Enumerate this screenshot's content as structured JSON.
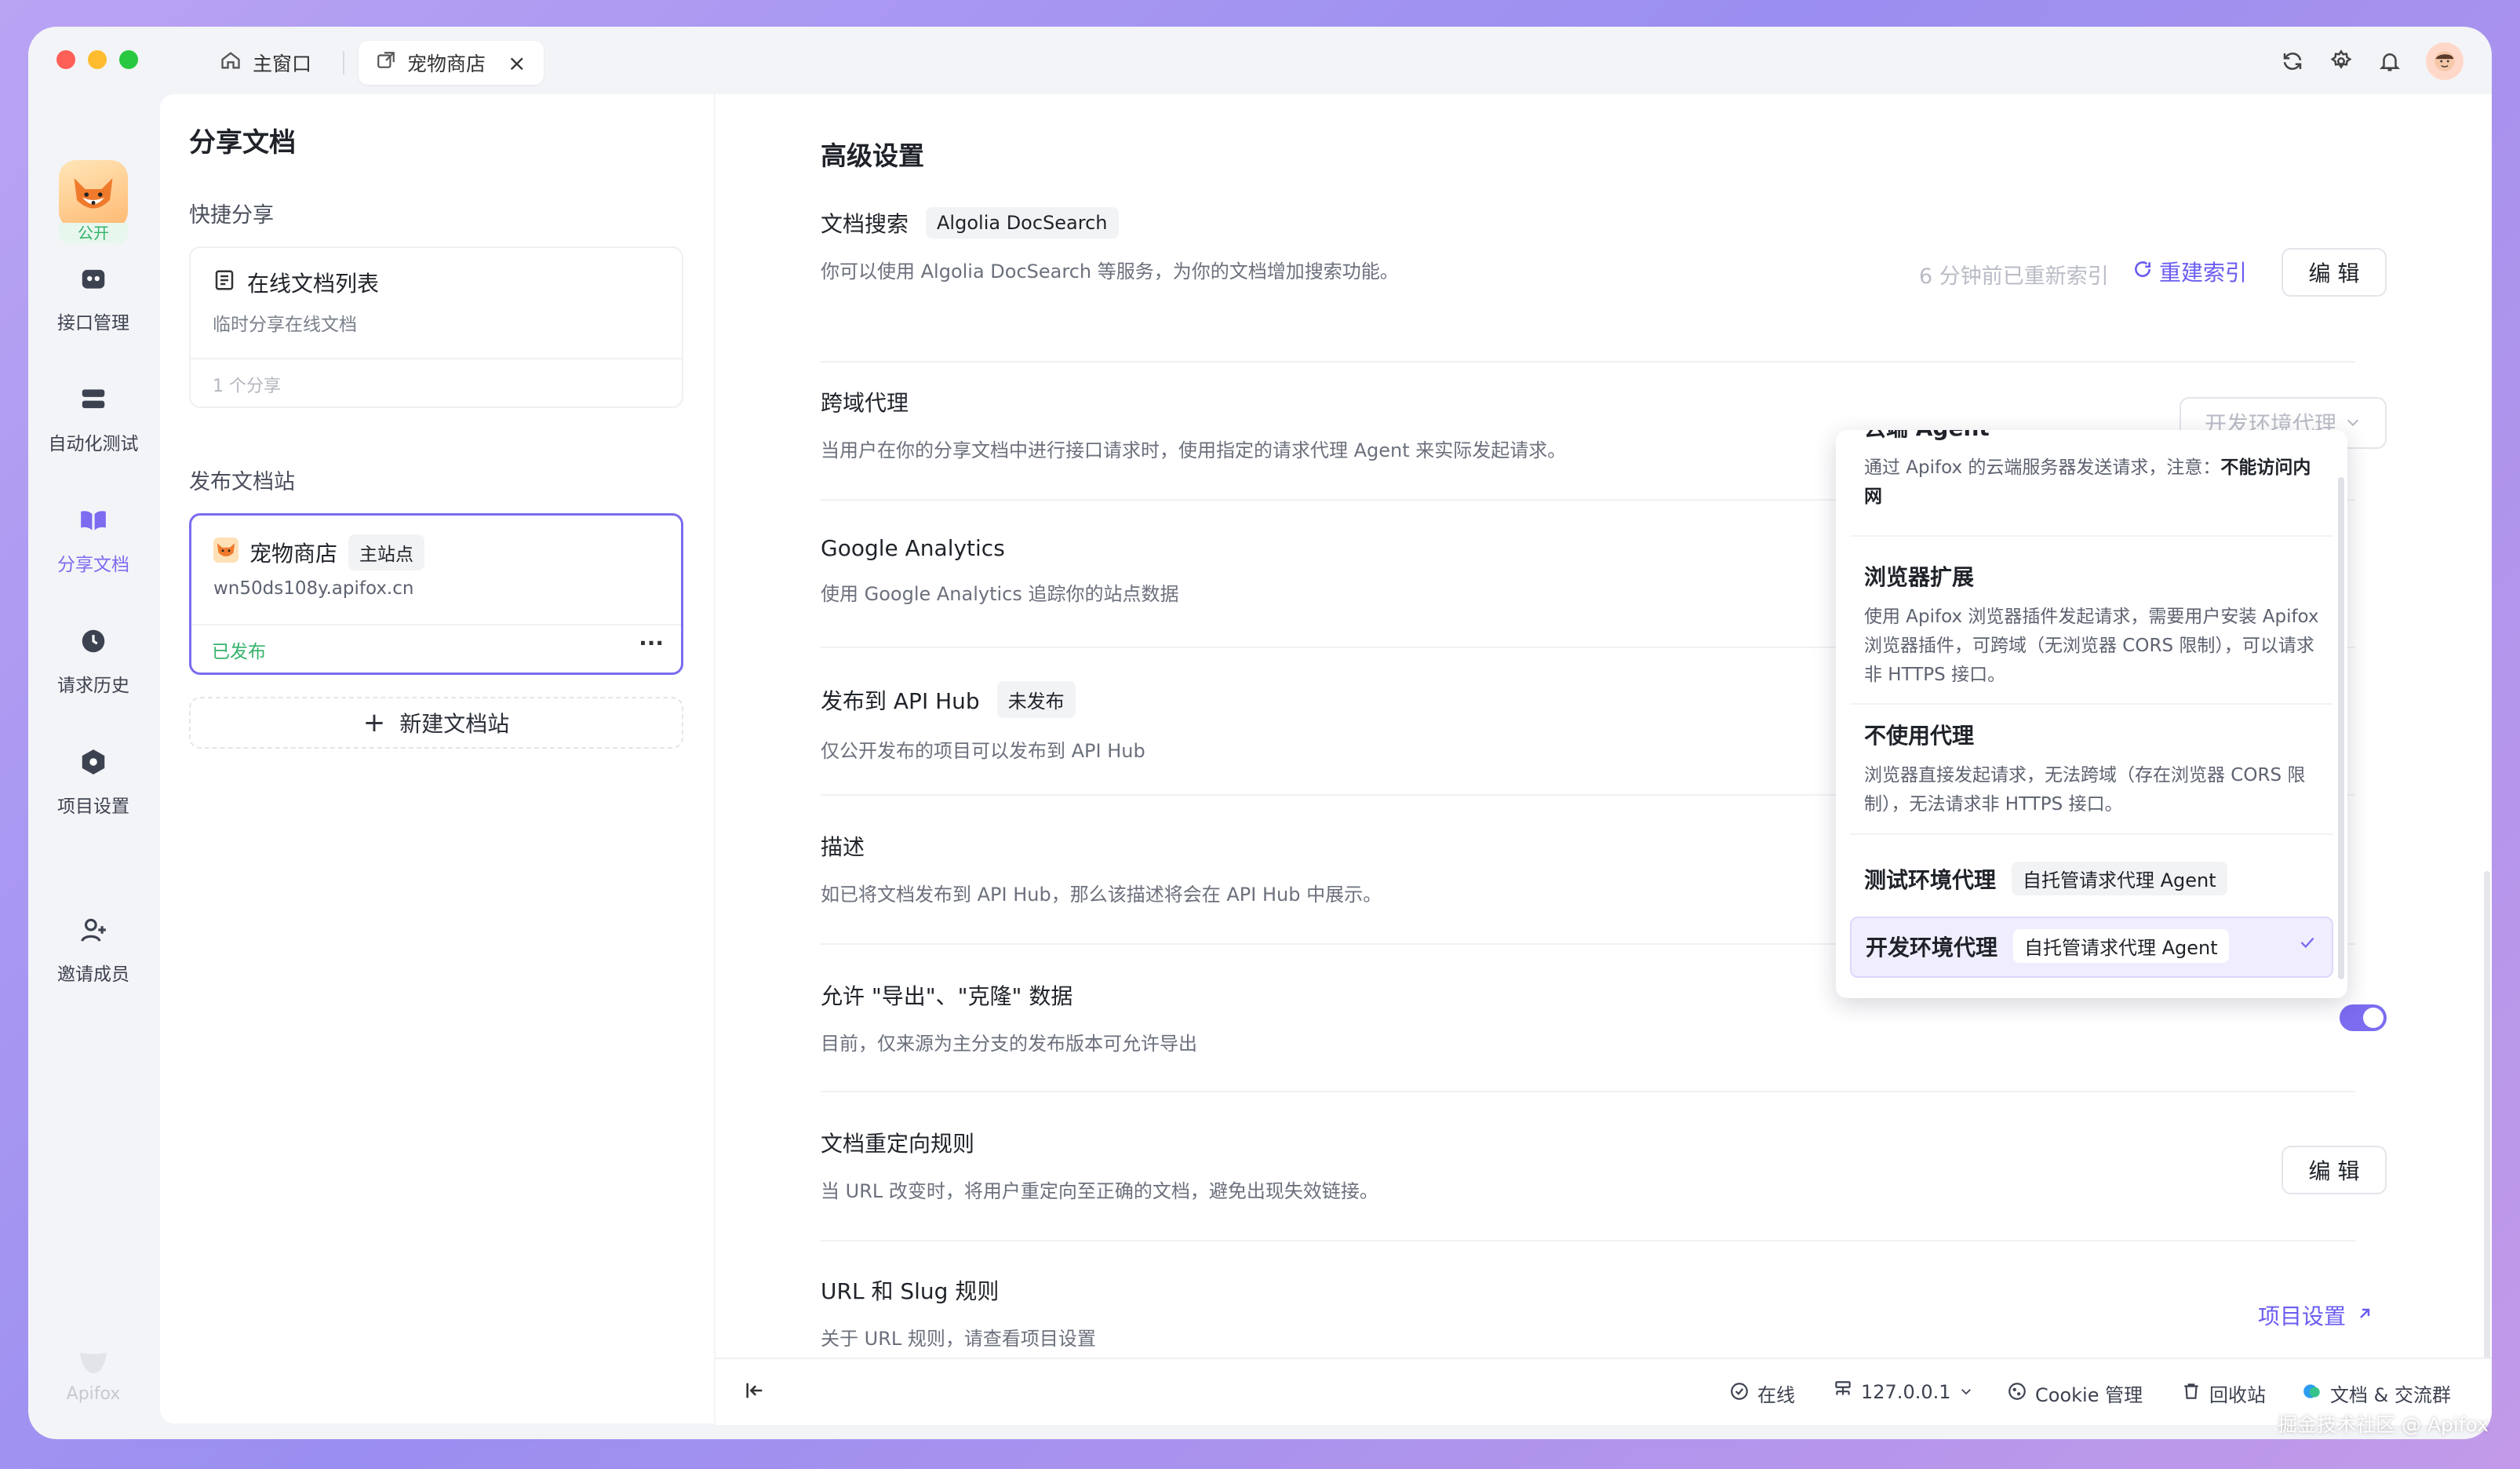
{
  "colors": {
    "accent": "#7b6cf0",
    "green": "#34b36b",
    "link": "#6a5cf0"
  },
  "tabs": [
    {
      "label": "主窗口",
      "icon": "home-icon"
    },
    {
      "label": "宠物商店",
      "icon": "external-link-icon"
    }
  ],
  "nav": {
    "public_badge": "公开",
    "items": [
      {
        "label": "接口管理",
        "icon": "api-icon"
      },
      {
        "label": "自动化测试",
        "icon": "automation-icon"
      },
      {
        "label": "分享文档",
        "icon": "book-icon"
      },
      {
        "label": "请求历史",
        "icon": "history-icon"
      },
      {
        "label": "项目设置",
        "icon": "settings-hex-icon"
      },
      {
        "label": "邀请成员",
        "icon": "invite-user-icon"
      }
    ],
    "brand": "Apifox"
  },
  "left_panel": {
    "title": "分享文档",
    "quick_share": "快捷分享",
    "online_docs": {
      "title": "在线文档列表",
      "sub": "临时分享在线文档",
      "count": "1 个分享"
    },
    "publish_section": "发布文档站",
    "site": {
      "name": "宠物商店",
      "tag": "主站点",
      "url": "wn50ds108y.apifox.cn",
      "status": "已发布",
      "more": "···"
    },
    "add_site": "新建文档站"
  },
  "main": {
    "title": "高级设置",
    "doc_search": {
      "title": "文档搜索",
      "tag": "Algolia DocSearch",
      "desc": "你可以使用 Algolia DocSearch 等服务，为你的文档增加搜索功能。",
      "reindex_time": "6 分钟前已重新索引",
      "reindex": "重建索引",
      "edit": "编 辑"
    },
    "proxy": {
      "title": "跨域代理",
      "desc": "当用户在你的分享文档中进行接口请求时，使用指定的请求代理 Agent 来实际发起请求。",
      "select": "开发环境代理"
    },
    "ga": {
      "title": "Google Analytics",
      "desc": "使用 Google Analytics 追踪你的站点数据"
    },
    "apihub": {
      "title": "发布到 API Hub",
      "tag": "未发布",
      "desc": "仅公开发布的项目可以发布到 API Hub"
    },
    "describe": {
      "title": "描述",
      "desc": "如已将文档发布到 API Hub，那么该描述将会在 API Hub 中展示。"
    },
    "export": {
      "title": "允许 \"导出\"、\"克隆\" 数据",
      "desc": "目前，仅来源为主分支的发布版本可允许导出"
    },
    "redirect": {
      "title": "文档重定向规则",
      "desc": "当 URL 改变时，将用户重定向至正确的文档，避免出现失效链接。",
      "edit": "编 辑"
    },
    "slug": {
      "title": "URL 和 Slug 规则",
      "desc": "关于 URL 规则，请查看项目设置",
      "link": "项目设置"
    }
  },
  "dropdown": {
    "cloud": {
      "title": "云端 Agent",
      "desc_a": "通过 Apifox 的云端服务器发送请求，注意：",
      "desc_b": "不能访问内网"
    },
    "browser": {
      "title": "浏览器扩展",
      "desc": "使用 Apifox 浏览器插件发起请求，需要用户安装 Apifox 浏览器插件，可跨域（无浏览器 CORS 限制），可以请求非 HTTPS 接口。"
    },
    "none": {
      "title": "不使用代理",
      "desc": "浏览器直接发起请求，无法跨域（存在浏览器 CORS 限制），无法请求非 HTTPS 接口。"
    },
    "test": {
      "title": "测试环境代理",
      "tag": "自托管请求代理 Agent"
    },
    "dev": {
      "title": "开发环境代理",
      "tag": "自托管请求代理 Agent"
    }
  },
  "status_bar": {
    "online": "在线",
    "host": "127.0.0.1",
    "cookie": "Cookie 管理",
    "trash": "回收站",
    "docs": "文档 & 交流群"
  },
  "watermark": "掘金技术社区 @ Apifox"
}
